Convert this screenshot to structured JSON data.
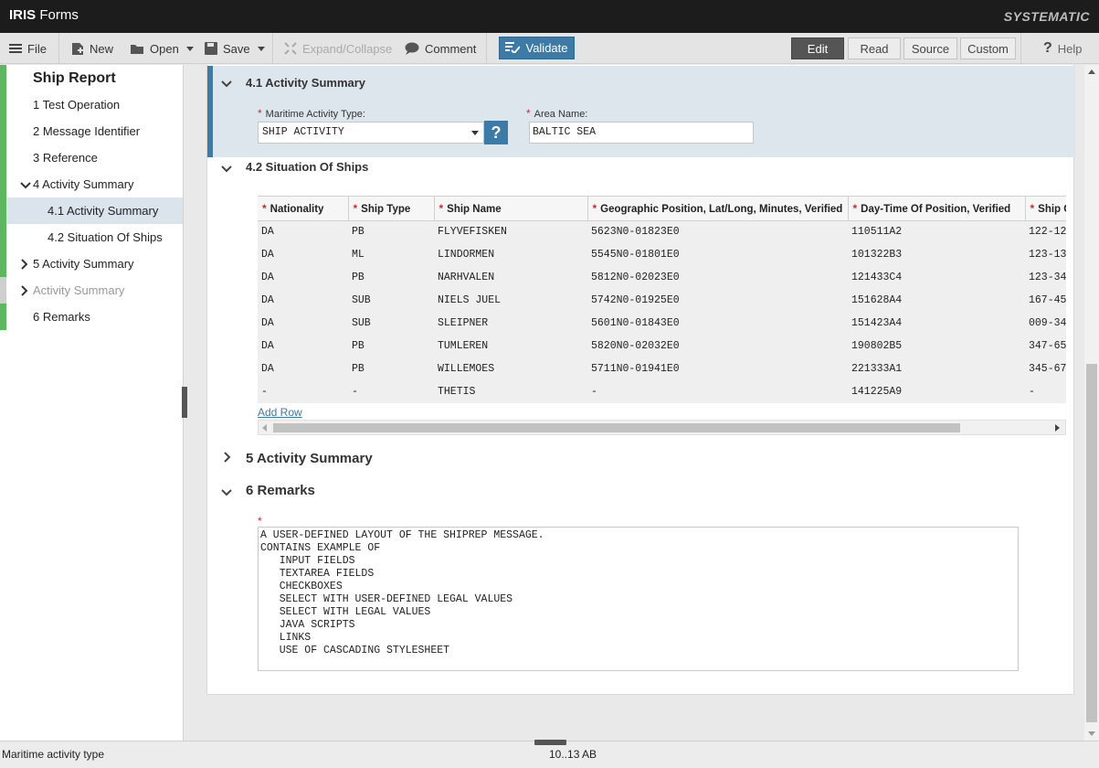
{
  "titlebar": {
    "app_name_bold": "IRIS",
    "app_name_rest": "Forms",
    "brand": "SYSTEMATIC"
  },
  "toolbar": {
    "file": "File",
    "new": "New",
    "open": "Open",
    "save": "Save",
    "expand_collapse": "Expand/Collapse",
    "comment": "Comment",
    "validate": "Validate",
    "modes": [
      "Edit",
      "Read",
      "Source",
      "Custom"
    ],
    "active_mode": "Edit",
    "help": "Help"
  },
  "sidebar": {
    "title": "Ship Report",
    "items": [
      {
        "label": "1 Test Operation"
      },
      {
        "label": "2 Message Identifier"
      },
      {
        "label": "3 Reference"
      },
      {
        "label": "4 Activity Summary"
      },
      {
        "label": "4.1 Activity Summary"
      },
      {
        "label": "4.2 Situation Of Ships"
      },
      {
        "label": "5 Activity Summary"
      },
      {
        "label": "Activity Summary"
      },
      {
        "label": "6 Remarks"
      }
    ]
  },
  "section_4_1": {
    "title": "4.1 Activity Summary",
    "activity_type_label": "Maritime Activity Type:",
    "activity_type_value": "SHIP ACTIVITY",
    "help_label": "?",
    "area_name_label": "Area Name:",
    "area_name_value": "BALTIC SEA"
  },
  "section_4_2": {
    "title": "4.2 Situation Of Ships",
    "columns": [
      "Nationality",
      "Ship Type",
      "Ship Name",
      "Geographic Position, Lat/Long, Minutes, Verified",
      "Day-Time Of Position, Verified",
      "Ship C"
    ],
    "rows": [
      [
        "DA",
        "PB",
        "FLYVEFISKEN",
        "5623N0-01823E0",
        "110511A2",
        "122-12"
      ],
      [
        "DA",
        "ML",
        "LINDORMEN",
        "5545N0-01801E0",
        "101322B3",
        "123-13"
      ],
      [
        "DA",
        "PB",
        "NARHVALEN",
        "5812N0-02023E0",
        "121433C4",
        "123-34"
      ],
      [
        "DA",
        "SUB",
        "NIELS JUEL",
        "5742N0-01925E0",
        "151628A4",
        "167-45"
      ],
      [
        "DA",
        "SUB",
        "SLEIPNER",
        "5601N0-01843E0",
        "151423A4",
        "009-34"
      ],
      [
        "DA",
        "PB",
        "TUMLEREN",
        "5820N0-02032E0",
        "190802B5",
        "347-65"
      ],
      [
        "DA",
        "PB",
        "WILLEMOES",
        "5711N0-01941E0",
        "221333A1",
        "345-67"
      ],
      [
        "-",
        "-",
        "THETIS",
        "-",
        "141225A9",
        "-"
      ]
    ],
    "add_row": "Add Row"
  },
  "section_5": {
    "title": "5 Activity Summary"
  },
  "section_6": {
    "title": "6 Remarks",
    "remarks": "A USER-DEFINED LAYOUT OF THE SHIPREP MESSAGE.\nCONTAINS EXAMPLE OF\n   INPUT FIELDS\n   TEXTAREA FIELDS\n   CHECKBOXES\n   SELECT WITH USER-DEFINED LEGAL VALUES\n   SELECT WITH LEGAL VALUES\n   JAVA SCRIPTS\n   LINKS\n   USE OF CASCADING STYLESHEET"
  },
  "statusbar": {
    "left": "Maritime activity type",
    "middle": "10..13 AB"
  },
  "colors": {
    "accent": "#3d7aa6",
    "valid_marker": "#5cb85c",
    "selected_nav": "#dbe4ec"
  }
}
